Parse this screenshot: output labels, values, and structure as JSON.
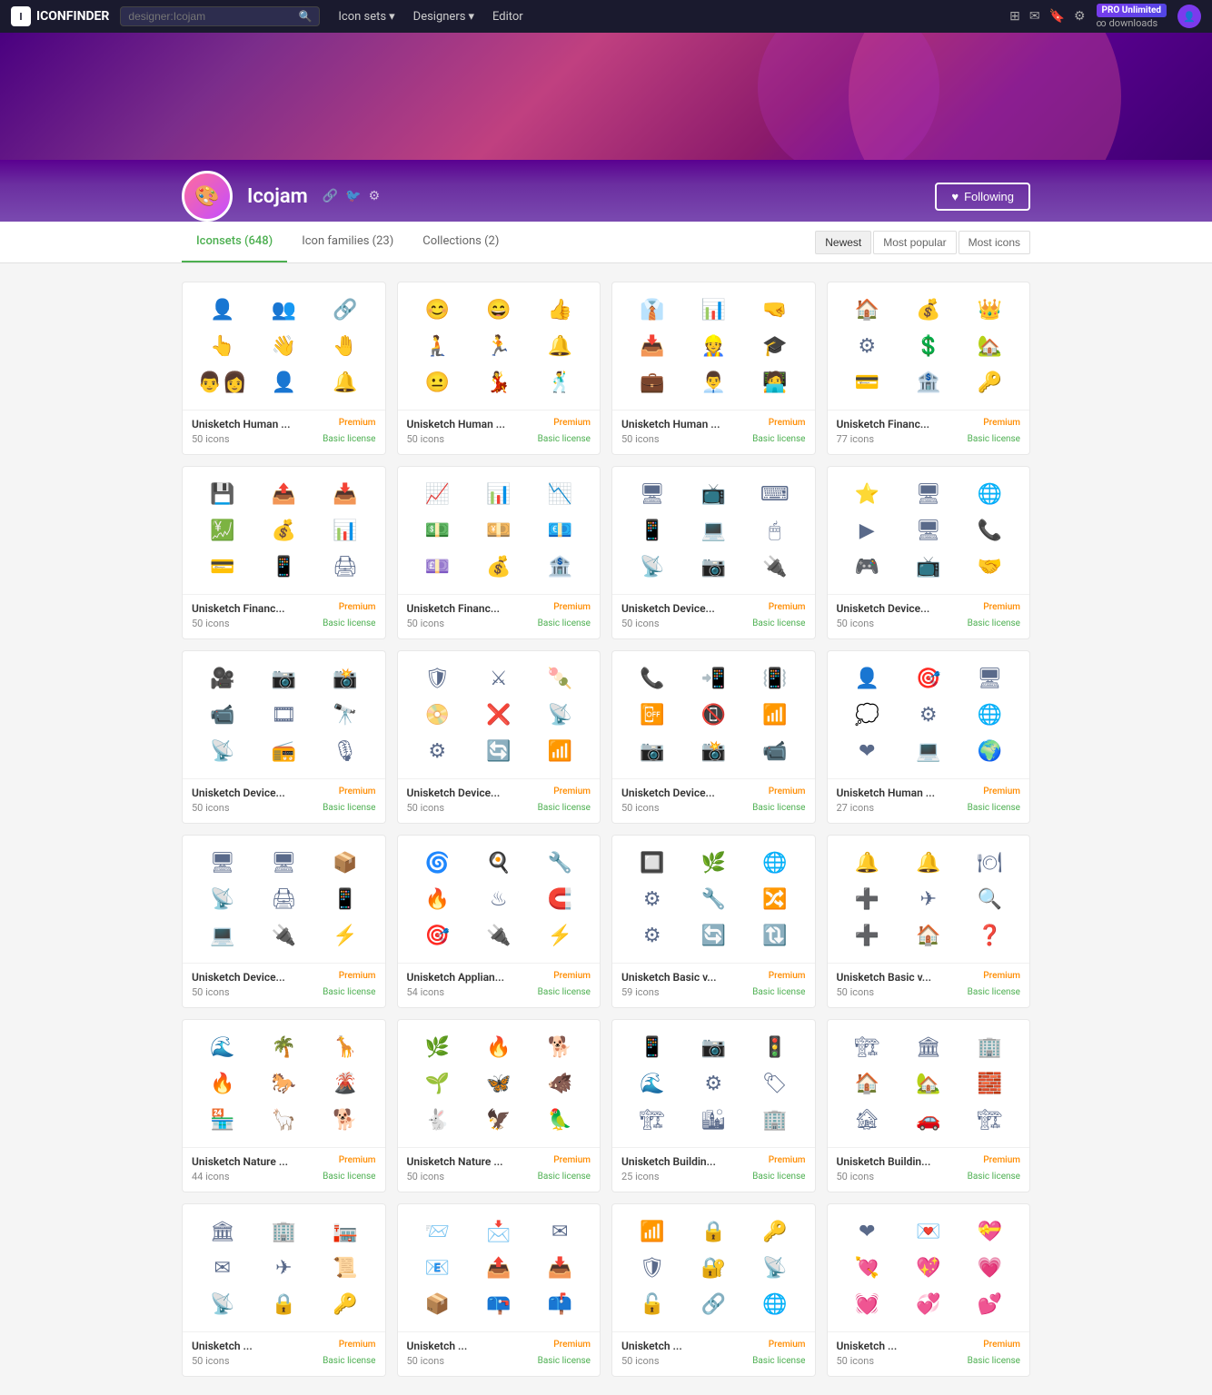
{
  "nav": {
    "logo": "ICONFINDER",
    "search_placeholder": "designer:Icojam",
    "links": [
      {
        "label": "Icon sets",
        "has_dropdown": true
      },
      {
        "label": "Designers",
        "has_dropdown": true
      },
      {
        "label": "Editor",
        "has_dropdown": false
      }
    ],
    "pro_label": "PRO Unlimited",
    "pro_sub": "∞ downloads"
  },
  "profile": {
    "name": "Icojam",
    "following_label": "Following",
    "heart": "♥"
  },
  "tabs": [
    {
      "label": "Iconsets (648)",
      "active": true
    },
    {
      "label": "Icon families (23)",
      "active": false
    },
    {
      "label": "Collections (2)",
      "active": false
    }
  ],
  "sort_buttons": [
    {
      "label": "Newest",
      "active": true
    },
    {
      "label": "Most popular",
      "active": false
    },
    {
      "label": "Most icons",
      "active": false
    }
  ],
  "icon_sets": [
    {
      "title": "Unisketch Human ...",
      "badge": "Premium",
      "count": "50 icons",
      "license": "Basic license",
      "icons": [
        "👤",
        "👥",
        "🔗",
        "👆",
        "👋",
        "🤚",
        "👨‍👩",
        "👤",
        "🔔"
      ]
    },
    {
      "title": "Unisketch Human ...",
      "badge": "Premium",
      "count": "50 icons",
      "license": "Basic license",
      "icons": [
        "😊",
        "😄",
        "👍",
        "🧎",
        "🏃",
        "🔔",
        "😐",
        "💃",
        "🕺"
      ]
    },
    {
      "title": "Unisketch Human ...",
      "badge": "Premium",
      "count": "50 icons",
      "license": "Basic license",
      "icons": [
        "👔",
        "📊",
        "🤜",
        "📥",
        "👷",
        "🎓",
        "💼",
        "👨‍💼",
        "🧑‍💻"
      ]
    },
    {
      "title": "Unisketch Financ...",
      "badge": "Premium",
      "count": "77 icons",
      "license": "Basic license",
      "icons": [
        "🏠",
        "💰",
        "👑",
        "⚙",
        "💲",
        "🏡",
        "💳",
        "🏦",
        "🔑"
      ]
    },
    {
      "title": "Unisketch Financ...",
      "badge": "Premium",
      "count": "50 icons",
      "license": "Basic license",
      "icons": [
        "💾",
        "📤",
        "📥",
        "💹",
        "💰",
        "📊",
        "💳",
        "📱",
        "🖨"
      ]
    },
    {
      "title": "Unisketch Financ...",
      "badge": "Premium",
      "count": "50 icons",
      "license": "Basic license",
      "icons": [
        "📈",
        "📊",
        "📉",
        "💵",
        "💴",
        "💶",
        "💷",
        "💰",
        "🏦"
      ]
    },
    {
      "title": "Unisketch Device...",
      "badge": "Premium",
      "count": "50 icons",
      "license": "Basic license",
      "icons": [
        "🖥",
        "📺",
        "⌨",
        "📱",
        "💻",
        "🖱",
        "📡",
        "📷",
        "🔌"
      ]
    },
    {
      "title": "Unisketch Device...",
      "badge": "Premium",
      "count": "50 icons",
      "license": "Basic license",
      "icons": [
        "⭐",
        "🖥",
        "🌐",
        "▶",
        "🖥",
        "📞",
        "🎮",
        "📺",
        "🤝"
      ]
    },
    {
      "title": "Unisketch Device...",
      "badge": "Premium",
      "count": "50 icons",
      "license": "Basic license",
      "icons": [
        "🎥",
        "📷",
        "📸",
        "📹",
        "🎞",
        "🔭",
        "📡",
        "📻",
        "🎙"
      ]
    },
    {
      "title": "Unisketch Device...",
      "badge": "Premium",
      "count": "50 icons",
      "license": "Basic license",
      "icons": [
        "🛡",
        "⚔",
        "🍡",
        "📀",
        "❌",
        "📡",
        "⚙",
        "🔄",
        "📶"
      ]
    },
    {
      "title": "Unisketch Device...",
      "badge": "Premium",
      "count": "50 icons",
      "license": "Basic license",
      "icons": [
        "📞",
        "📲",
        "📳",
        "📴",
        "📵",
        "📶",
        "📷",
        "📸",
        "📹"
      ]
    },
    {
      "title": "Unisketch Human ...",
      "badge": "Premium",
      "count": "27 icons",
      "license": "Basic license",
      "icons": [
        "👤",
        "🎯",
        "🖥",
        "💭",
        "⚙",
        "🌐",
        "❤",
        "💻",
        "🌍"
      ]
    },
    {
      "title": "Unisketch Device...",
      "badge": "Premium",
      "count": "50 icons",
      "license": "Basic license",
      "icons": [
        "🖥",
        "🖥",
        "📦",
        "📡",
        "🖨",
        "📱",
        "💻",
        "🔌",
        "⚡"
      ]
    },
    {
      "title": "Unisketch Applian...",
      "badge": "Premium",
      "count": "54 icons",
      "license": "Basic license",
      "icons": [
        "🌀",
        "🍳",
        "🔧",
        "🔥",
        "♨",
        "🧲",
        "🎯",
        "🔌",
        "⚡"
      ]
    },
    {
      "title": "Unisketch Basic v...",
      "badge": "Premium",
      "count": "59 icons",
      "license": "Basic license",
      "icons": [
        "🔲",
        "🌿",
        "🌐",
        "⚙",
        "🔧",
        "🔀",
        "⚙",
        "🔄",
        "🔃"
      ]
    },
    {
      "title": "Unisketch Basic v...",
      "badge": "Premium",
      "count": "50 icons",
      "license": "Basic license",
      "icons": [
        "🔔",
        "🔔",
        "🍽",
        "➕",
        "✈",
        "🔍",
        "➕",
        "🏠",
        "❓"
      ]
    },
    {
      "title": "Unisketch Nature ...",
      "badge": "Premium",
      "count": "44 icons",
      "license": "Basic license",
      "icons": [
        "🌊",
        "🌴",
        "🦒",
        "🔥",
        "🐎",
        "🌋",
        "🏪",
        "🦙",
        "🐕"
      ]
    },
    {
      "title": "Unisketch Nature ...",
      "badge": "Premium",
      "count": "50 icons",
      "license": "Basic license",
      "icons": [
        "🌿",
        "🔥",
        "🐕",
        "🌱",
        "🦋",
        "🐗",
        "🐇",
        "🦅",
        "🦜"
      ]
    },
    {
      "title": "Unisketch Buildin...",
      "badge": "Premium",
      "count": "25 icons",
      "license": "Basic license",
      "icons": [
        "📱",
        "📷",
        "🚦",
        "🌊",
        "⚙",
        "🏷",
        "🏗",
        "🏙",
        "🏢"
      ]
    },
    {
      "title": "Unisketch Buildin...",
      "badge": "Premium",
      "count": "50 icons",
      "license": "Basic license",
      "icons": [
        "🏗",
        "🏛",
        "🏢",
        "🏠",
        "🏡",
        "🧱",
        "🏚",
        "🚗",
        "🏗"
      ]
    },
    {
      "title": "Unisketch ...",
      "badge": "Premium",
      "count": "50 icons",
      "license": "Basic license",
      "icons": [
        "🏛",
        "🏢",
        "🏣",
        "✉",
        "✈",
        "📜",
        "📡",
        "🔒",
        "🔑"
      ]
    },
    {
      "title": "Unisketch ...",
      "badge": "Premium",
      "count": "50 icons",
      "license": "Basic license",
      "icons": [
        "📨",
        "📩",
        "✉",
        "📧",
        "📤",
        "📥",
        "📦",
        "📪",
        "📫"
      ]
    },
    {
      "title": "Unisketch ...",
      "badge": "Premium",
      "count": "50 icons",
      "license": "Basic license",
      "icons": [
        "📶",
        "🔒",
        "🔑",
        "🛡",
        "🔐",
        "📡",
        "🔓",
        "🔗",
        "🌐"
      ]
    },
    {
      "title": "Unisketch ...",
      "badge": "Premium",
      "count": "50 icons",
      "license": "Basic license",
      "icons": [
        "❤",
        "💌",
        "💝",
        "💘",
        "💖",
        "💗",
        "💓",
        "💞",
        "💕"
      ]
    }
  ]
}
